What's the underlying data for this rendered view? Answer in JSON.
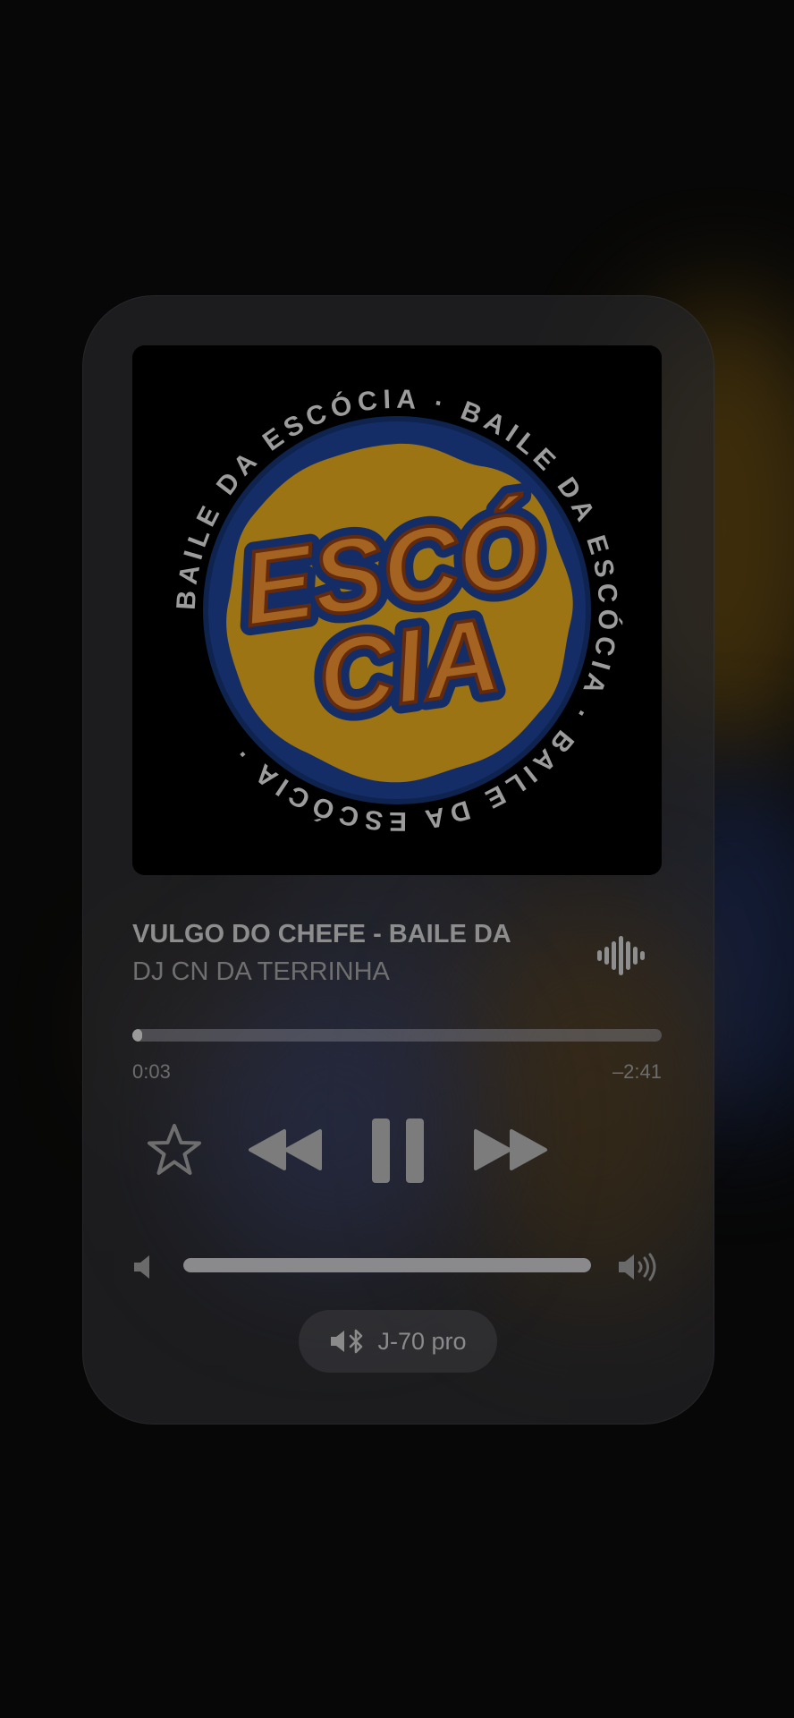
{
  "now_playing": {
    "title": "VULGO DO CHEFE  - BAILE DA",
    "artist": "DJ CN DA TERRINHA",
    "artwork": {
      "ring_text": "BAILE DA ESCÓCIA · BAILE DA ESCÓCIA · BAILE DA ESCÓCIA ·",
      "logo_line1": "ESCÓ",
      "logo_line2": "CIA"
    }
  },
  "playback": {
    "elapsed": "0:03",
    "remaining": "–2:41",
    "progress_fraction": 0.018,
    "state": "playing"
  },
  "volume": {
    "level_fraction": 1.0
  },
  "route": {
    "device_name": "J-70 pro",
    "icon": "speaker-bluetooth-icon"
  },
  "icons": {
    "favorite": "star-icon",
    "rewind": "rewind-icon",
    "pause": "pause-icon",
    "fast_forward": "fast-forward-icon",
    "waveform": "waveform-icon",
    "volume_low": "volume-low-icon",
    "volume_high": "volume-high-icon"
  },
  "colors": {
    "background": "#070707",
    "card": "#262628",
    "artwork_blue": "#1d3f8e",
    "artwork_gold": "#d9a11d",
    "logo_orange": "#e38a2e"
  }
}
